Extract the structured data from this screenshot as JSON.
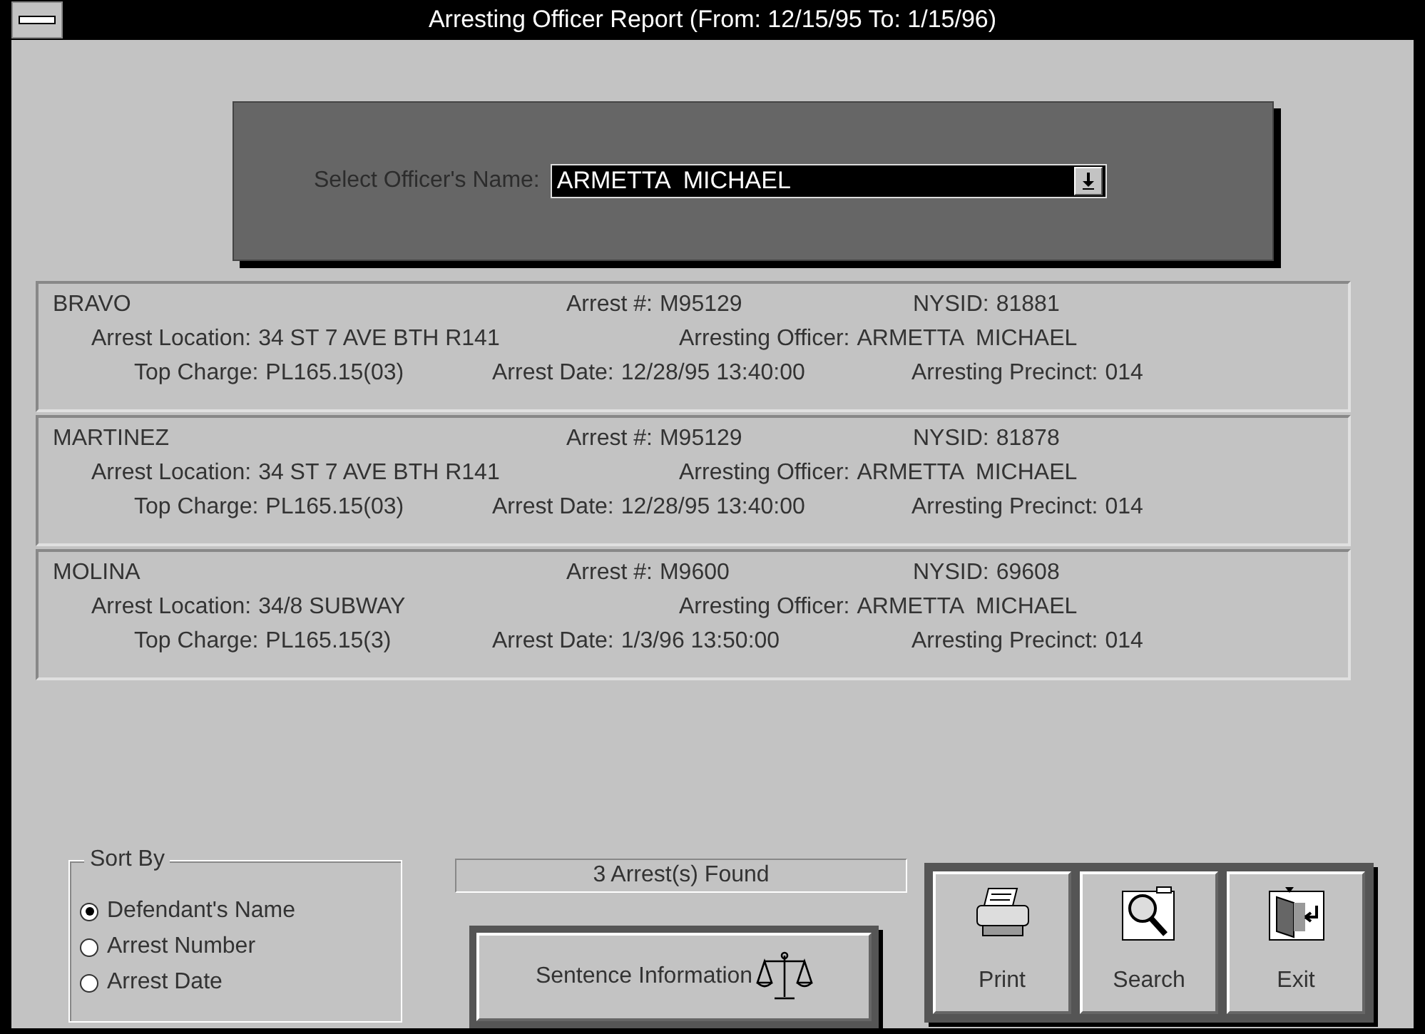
{
  "window": {
    "title": "Arresting Officer Report (From: 12/15/95 To: 1/15/96)"
  },
  "officer_select": {
    "label": "Select Officer's Name:",
    "value": "ARMETTA  MICHAEL"
  },
  "records": [
    {
      "name": "BRAVO",
      "fields": [
        {
          "label": "Arrest #:",
          "value": "M95129"
        },
        {
          "label": "NYSID:",
          "value": "81881"
        },
        {
          "label": "Arrest Location:",
          "value": "34 ST 7 AVE BTH R141"
        },
        {
          "label": "Arresting Officer:",
          "value": "ARMETTA  MICHAEL"
        },
        {
          "label": "Top Charge:",
          "value": "PL165.15(03)"
        },
        {
          "label": "Arrest Date:",
          "value": "12/28/95 13:40:00"
        },
        {
          "label": "Arresting Precinct:",
          "value": "014"
        }
      ]
    },
    {
      "name": "MARTINEZ",
      "fields": [
        {
          "label": "Arrest #:",
          "value": "M95129"
        },
        {
          "label": "NYSID:",
          "value": "81878"
        },
        {
          "label": "Arrest Location:",
          "value": "34 ST 7 AVE BTH R141"
        },
        {
          "label": "Arresting Officer:",
          "value": "ARMETTA  MICHAEL"
        },
        {
          "label": "Top Charge:",
          "value": "PL165.15(03)"
        },
        {
          "label": "Arrest Date:",
          "value": "12/28/95 13:40:00"
        },
        {
          "label": "Arresting Precinct:",
          "value": "014"
        }
      ]
    },
    {
      "name": "MOLINA",
      "fields": [
        {
          "label": "Arrest #:",
          "value": "M9600"
        },
        {
          "label": "NYSID:",
          "value": "69608"
        },
        {
          "label": "Arrest Location:",
          "value": "34/8 SUBWAY"
        },
        {
          "label": "Arresting Officer:",
          "value": "ARMETTA  MICHAEL"
        },
        {
          "label": "Top Charge:",
          "value": "PL165.15(3)"
        },
        {
          "label": "Arrest Date:",
          "value": "1/3/96 13:50:00"
        },
        {
          "label": "Arresting Precinct:",
          "value": "014"
        }
      ]
    }
  ],
  "sort_by": {
    "title": "Sort By",
    "options": [
      {
        "label": "Defendant's Name",
        "selected": true
      },
      {
        "label": "Arrest Number",
        "selected": false
      },
      {
        "label": "Arrest Date",
        "selected": false
      }
    ]
  },
  "status": "3 Arrest(s) Found",
  "sentence_button": "Sentence Information",
  "buttons": [
    {
      "kind": "print",
      "label": "Print"
    },
    {
      "kind": "search",
      "label": "Search"
    },
    {
      "kind": "exit",
      "label": "Exit"
    }
  ]
}
